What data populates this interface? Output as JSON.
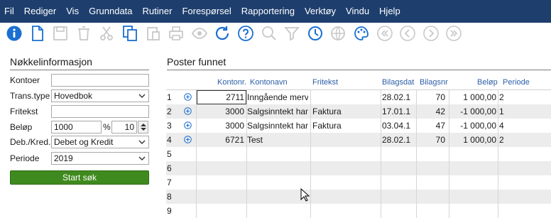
{
  "menu": [
    "Fil",
    "Rediger",
    "Vis",
    "Grunndata",
    "Rutiner",
    "Forespørsel",
    "Rapportering",
    "Verktøy",
    "Vindu",
    "Hjelp"
  ],
  "toolbar_icons": [
    "info-icon",
    "new-document-icon",
    "save-icon",
    "delete-icon",
    "cut-icon",
    "copy-icon",
    "paste-icon",
    "print-icon",
    "preview-icon",
    "refresh-icon",
    "help-icon",
    "search-icon",
    "filter-icon",
    "history-icon",
    "globe-icon",
    "palette-icon",
    "first-icon",
    "previous-icon",
    "next-icon",
    "last-icon"
  ],
  "colors": {
    "menubar": "#1e3f6e",
    "accent": "#1a6fd0",
    "button_green": "#3f8a1e"
  },
  "left": {
    "title": "Nøkkelinformasjon",
    "fields": {
      "kontoer": {
        "label": "Kontoer",
        "value": ""
      },
      "transtype": {
        "label": "Trans.type",
        "value": "Hovedbok"
      },
      "fritekst": {
        "label": "Fritekst",
        "value": ""
      },
      "belop": {
        "label": "Beløp",
        "value": "1000",
        "percent_symbol": "%",
        "percent": "10"
      },
      "debkred": {
        "label": "Deb./Kred.",
        "value": "Debet og Kredit"
      },
      "periode": {
        "label": "Periode",
        "value": "2019"
      }
    },
    "start_button": "Start søk"
  },
  "right": {
    "title": "Poster funnet",
    "columns": [
      "Kontonr.",
      "Kontonavn",
      "Fritekst",
      "Bilagsdat",
      "Bilagsnr",
      "Beløp",
      "Periode"
    ],
    "rows": [
      {
        "n": "1",
        "kontonr": "2711",
        "kontonavn": "Inngående merve",
        "fritekst": "",
        "bilagsdato": "28.02.1",
        "bilagsnr": "70",
        "belop": "1 000,00",
        "periode": "2"
      },
      {
        "n": "2",
        "kontonr": "3000",
        "kontonavn": "Salgsinntekt hand",
        "fritekst": "Faktura",
        "bilagsdato": "17.01.1",
        "bilagsnr": "42",
        "belop": "-1 000,00",
        "periode": "1"
      },
      {
        "n": "3",
        "kontonr": "3000",
        "kontonavn": "Salgsinntekt hand",
        "fritekst": "Faktura",
        "bilagsdato": "03.04.1",
        "bilagsnr": "47",
        "belop": "-1 000,00",
        "periode": "4"
      },
      {
        "n": "4",
        "kontonr": "6721",
        "kontonavn": "Test",
        "fritekst": "",
        "bilagsdato": "28.02.1",
        "bilagsnr": "70",
        "belop": "1 000,00",
        "periode": "2"
      },
      {
        "n": "5"
      },
      {
        "n": "6"
      },
      {
        "n": "7"
      },
      {
        "n": "8"
      },
      {
        "n": "9"
      }
    ]
  }
}
